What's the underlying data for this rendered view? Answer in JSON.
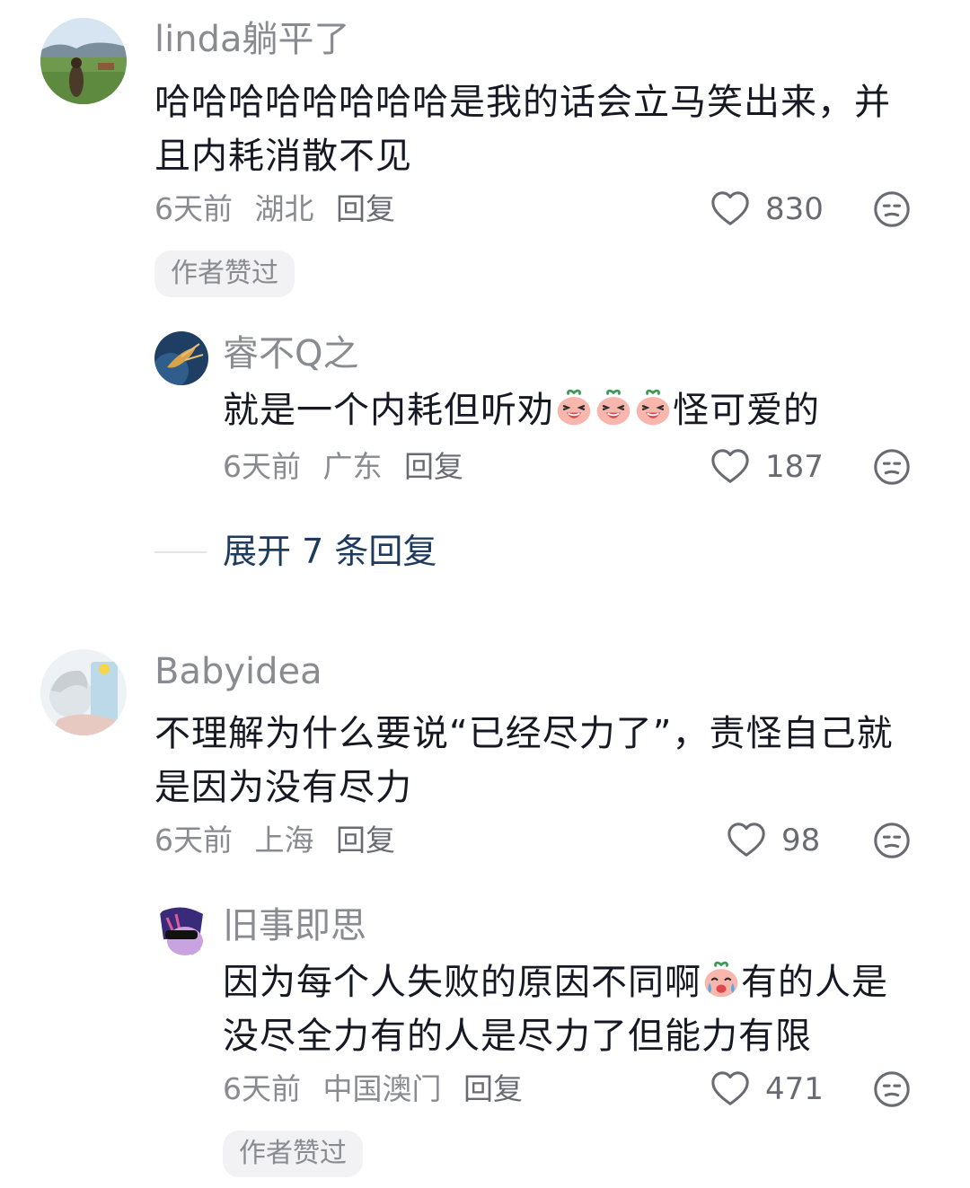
{
  "comments": [
    {
      "username": "linda躺平了",
      "text": "哈哈哈哈哈哈哈哈是我的话会立马笑出来，并且内耗消散不见",
      "time": "6天前",
      "location": "湖北",
      "reply_label": "回复",
      "likes": "830",
      "badge": "作者赞过",
      "replies": [
        {
          "username": "睿不Q之",
          "text_before": "就是一个内耗但听劝",
          "text_after": "怪可爱的",
          "emoji": "laughing-peach-emoji",
          "time": "6天前",
          "location": "广东",
          "reply_label": "回复",
          "likes": "187"
        }
      ],
      "expand_label": "展开 7 条回复"
    },
    {
      "username": "Babyidea",
      "text": "不理解为什么要说“已经尽力了”，责怪自己就是因为没有尽力",
      "time": "6天前",
      "location": "上海",
      "reply_label": "回复",
      "likes": "98",
      "replies": [
        {
          "username": "旧事即思",
          "text_before": "因为每个人失败的原因不同啊",
          "text_after": "有的人是没尽全力有的人是尽力了但能力有限",
          "emoji": "crying-peach-emoji",
          "time": "6天前",
          "location": "中国澳门",
          "reply_label": "回复",
          "likes": "471",
          "badge": "作者赞过"
        }
      ]
    }
  ]
}
